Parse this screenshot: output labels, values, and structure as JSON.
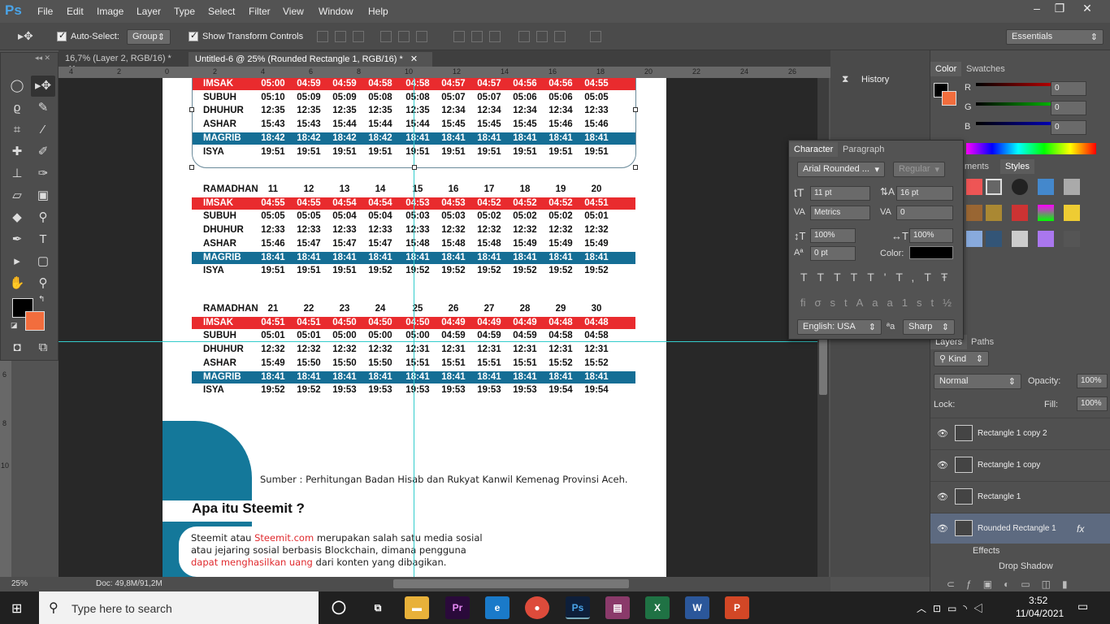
{
  "app": {
    "logo": "Ps"
  },
  "menu": [
    "File",
    "Edit",
    "Image",
    "Layer",
    "Type",
    "Select",
    "Filter",
    "View",
    "Window",
    "Help"
  ],
  "options": {
    "auto_select": "Auto-Select:",
    "group": "Group",
    "show_transform": "Show Transform Controls",
    "workspace": "Essentials"
  },
  "tabs": [
    {
      "label": "16,7% (Layer 2, RGB/16) *"
    },
    {
      "label": "Untitled-6 @ 25% (Rounded Rectangle 1, RGB/16) *"
    }
  ],
  "ruler_h": [
    "4",
    "2",
    "0",
    "2",
    "4",
    "6",
    "8",
    "10",
    "12",
    "14",
    "16",
    "18",
    "20",
    "22",
    "24",
    "26"
  ],
  "ruler_v": [
    "6",
    "8",
    "10"
  ],
  "table1": {
    "rows": [
      {
        "label": "IMSAK",
        "style": "red",
        "values": [
          "05:00",
          "04:59",
          "04:59",
          "04:58",
          "04:58",
          "04:57",
          "04:57",
          "04:56",
          "04:56",
          "04:55"
        ]
      },
      {
        "label": "SUBUH",
        "style": "plain",
        "values": [
          "05:10",
          "05:09",
          "05:09",
          "05:08",
          "05:08",
          "05:07",
          "05:07",
          "05:06",
          "05:06",
          "05:05"
        ]
      },
      {
        "label": "DHUHUR",
        "style": "plain",
        "values": [
          "12:35",
          "12:35",
          "12:35",
          "12:35",
          "12:35",
          "12:34",
          "12:34",
          "12:34",
          "12:34",
          "12:33"
        ]
      },
      {
        "label": "ASHAR",
        "style": "plain",
        "values": [
          "15:43",
          "15:43",
          "15:44",
          "15:44",
          "15:44",
          "15:45",
          "15:45",
          "15:45",
          "15:46",
          "15:46"
        ]
      },
      {
        "label": "MAGRIB",
        "style": "blue",
        "values": [
          "18:42",
          "18:42",
          "18:42",
          "18:42",
          "18:41",
          "18:41",
          "18:41",
          "18:41",
          "18:41",
          "18:41"
        ]
      },
      {
        "label": "ISYA",
        "style": "plain",
        "values": [
          "19:51",
          "19:51",
          "19:51",
          "19:51",
          "19:51",
          "19:51",
          "19:51",
          "19:51",
          "19:51",
          "19:51"
        ]
      }
    ]
  },
  "table2": {
    "rows": [
      {
        "label": "RAMADHAN",
        "style": "hdr",
        "values": [
          "11",
          "12",
          "13",
          "14",
          "15",
          "16",
          "17",
          "18",
          "19",
          "20"
        ]
      },
      {
        "label": "IMSAK",
        "style": "red",
        "values": [
          "04:55",
          "04:55",
          "04:54",
          "04:54",
          "04:53",
          "04:53",
          "04:52",
          "04:52",
          "04:52",
          "04:51"
        ]
      },
      {
        "label": "SUBUH",
        "style": "plain",
        "values": [
          "05:05",
          "05:05",
          "05:04",
          "05:04",
          "05:03",
          "05:03",
          "05:02",
          "05:02",
          "05:02",
          "05:01"
        ]
      },
      {
        "label": "DHUHUR",
        "style": "plain",
        "values": [
          "12:33",
          "12:33",
          "12:33",
          "12:33",
          "12:33",
          "12:32",
          "12:32",
          "12:32",
          "12:32",
          "12:32"
        ]
      },
      {
        "label": "ASHAR",
        "style": "plain",
        "values": [
          "15:46",
          "15:47",
          "15:47",
          "15:47",
          "15:48",
          "15:48",
          "15:48",
          "15:49",
          "15:49",
          "15:49"
        ]
      },
      {
        "label": "MAGRIB",
        "style": "blue",
        "values": [
          "18:41",
          "18:41",
          "18:41",
          "18:41",
          "18:41",
          "18:41",
          "18:41",
          "18:41",
          "18:41",
          "18:41"
        ]
      },
      {
        "label": "ISYA",
        "style": "plain",
        "values": [
          "19:51",
          "19:51",
          "19:51",
          "19:52",
          "19:52",
          "19:52",
          "19:52",
          "19:52",
          "19:52",
          "19:52"
        ]
      }
    ]
  },
  "table3": {
    "rows": [
      {
        "label": "RAMADHAN",
        "style": "hdr",
        "values": [
          "21",
          "22",
          "23",
          "24",
          "25",
          "26",
          "27",
          "28",
          "29",
          "30"
        ]
      },
      {
        "label": "IMSAK",
        "style": "red",
        "values": [
          "04:51",
          "04:51",
          "04:50",
          "04:50",
          "04:50",
          "04:49",
          "04:49",
          "04:49",
          "04:48",
          "04:48"
        ]
      },
      {
        "label": "SUBUH",
        "style": "plain",
        "values": [
          "05:01",
          "05:01",
          "05:00",
          "05:00",
          "05:00",
          "04:59",
          "04:59",
          "04:59",
          "04:58",
          "04:58"
        ]
      },
      {
        "label": "DHUHUR",
        "style": "plain",
        "values": [
          "12:32",
          "12:32",
          "12:32",
          "12:32",
          "12:31",
          "12:31",
          "12:31",
          "12:31",
          "12:31",
          "12:31"
        ]
      },
      {
        "label": "ASHAR",
        "style": "plain",
        "values": [
          "15:49",
          "15:50",
          "15:50",
          "15:50",
          "15:51",
          "15:51",
          "15:51",
          "15:51",
          "15:52",
          "15:52"
        ]
      },
      {
        "label": "MAGRIB",
        "style": "blue",
        "values": [
          "18:41",
          "18:41",
          "18:41",
          "18:41",
          "18:41",
          "18:41",
          "18:41",
          "18:41",
          "18:41",
          "18:41"
        ]
      },
      {
        "label": "ISYA",
        "style": "plain",
        "values": [
          "19:52",
          "19:52",
          "19:53",
          "19:53",
          "19:53",
          "19:53",
          "19:53",
          "19:53",
          "19:54",
          "19:54"
        ]
      }
    ]
  },
  "doc": {
    "source": "Sumber : Perhitungan Badan Hisab dan Rukyat Kanwil Kemenag Provinsi Aceh.",
    "heading": "Apa itu Steemit ?",
    "p1_a": "Steemit atau ",
    "p1_link": "Steemit.com",
    "p1_b": " merupakan salah satu media sosial",
    "p2": "atau jejaring sosial berbasis Blockchain, dimana pengguna",
    "p3_link": "dapat menghasilkan uang",
    "p3_b": " dari konten yang dibagikan."
  },
  "status": {
    "zoom": "25%",
    "doc": "Doc: 49,8M/91,2M"
  },
  "history": {
    "label": "History"
  },
  "color_panel": {
    "tabs": [
      "Color",
      "Swatches"
    ],
    "r": "R",
    "g": "G",
    "b": "B",
    "r_val": "0",
    "g_val": "0",
    "b_val": "0"
  },
  "character": {
    "tabs": [
      "Character",
      "Paragraph"
    ],
    "font": "Arial Rounded ...",
    "style": "Regular",
    "size": "11 pt",
    "leading": "16 pt",
    "kerning": "Metrics",
    "tracking": "0",
    "v_scale": "100%",
    "h_scale": "100%",
    "baseline": "0 pt",
    "color_label": "Color:",
    "language": "English: USA",
    "aa_label": "ªa",
    "aa": "Sharp"
  },
  "styles_panel": {
    "tabs": [
      "ments",
      "Styles"
    ]
  },
  "layers": {
    "tabs": [
      "Layers",
      "Paths"
    ],
    "kind": "Kind",
    "blend": "Normal",
    "opacity_label": "Opacity:",
    "opacity": "100%",
    "lock_label": "Lock:",
    "fill_label": "Fill:",
    "fill": "100%",
    "items": [
      {
        "name": "Rectangle 1 copy 2"
      },
      {
        "name": "Rectangle 1 copy"
      },
      {
        "name": "Rectangle 1"
      },
      {
        "name": "Rounded Rectangle 1",
        "fx": "fx"
      }
    ],
    "effects": "Effects",
    "drop_shadow": "Drop Shadow"
  },
  "taskbar": {
    "search": "Type here to search",
    "time": "3:52",
    "date": "11/04/2021"
  },
  "colors": {
    "red": "#e92b2e",
    "blue": "#156e95",
    "link": "#e02a2e",
    "teal": "#14789a",
    "bg_swatch": "#f26d3d"
  }
}
